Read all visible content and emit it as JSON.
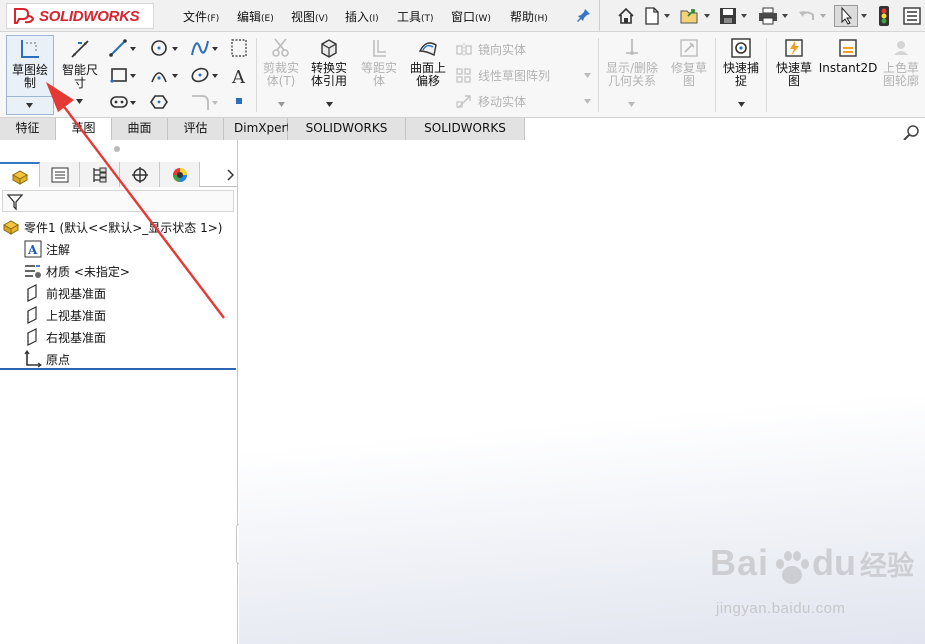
{
  "app": {
    "brand": "SOLIDWORKS",
    "accent_red": "#d9232e",
    "selection_blue": "#3a74c4"
  },
  "menubar": {
    "items": [
      {
        "label": "文件",
        "key": "(F)"
      },
      {
        "label": "编辑",
        "key": "(E)"
      },
      {
        "label": "视图",
        "key": "(V)"
      },
      {
        "label": "插入",
        "key": "(I)"
      },
      {
        "label": "工具",
        "key": "(T)"
      },
      {
        "label": "窗口",
        "key": "(W)"
      },
      {
        "label": "帮助",
        "key": "(H)"
      }
    ],
    "pin_icon": "pin-icon",
    "quick_access_icons": [
      "home-icon",
      "new-document-icon",
      "open-folder-icon",
      "save-icon",
      "print-icon",
      "undo-icon",
      "select-cursor-icon",
      "traffic-light-icon",
      "options-list-icon"
    ]
  },
  "ribbon": {
    "sketch": {
      "label1": "草图绘",
      "label2": "制"
    },
    "smart_dimension": {
      "label1": "智能尺",
      "label2": "寸"
    },
    "trim": {
      "label1": "剪裁实",
      "label2": "体(T)"
    },
    "convert": {
      "label1": "转换实",
      "label2": "体引用"
    },
    "offset": {
      "label1": "等距实",
      "label2": "体"
    },
    "offset_surface": {
      "label1": "曲面上",
      "label2": "偏移"
    },
    "mirror": "镜向实体",
    "linear_pattern": "线性草图阵列",
    "move": "移动实体",
    "display_relations": {
      "label1": "显示/删除",
      "label2": "几何关系"
    },
    "repair": {
      "label1": "修复草",
      "label2": "图"
    },
    "quick_snaps": {
      "label1": "快速捕",
      "label2": "捉"
    },
    "rapid_sketch": {
      "label1": "快速草",
      "label2": "图"
    },
    "instant2d": "Instant2D",
    "shaded_contours": {
      "label1": "上色草",
      "label2": "图轮廓"
    }
  },
  "tabs": [
    "特征",
    "草图",
    "曲面",
    "评估",
    "DimXpert",
    "SOLIDWORKS 插件",
    "SOLIDWORKS MBD"
  ],
  "active_tab": "草图",
  "feature_tree": {
    "root": "零件1  (默认<<默认>_显示状态 1>)",
    "items": [
      {
        "icon": "annotations-icon",
        "label": "注解"
      },
      {
        "icon": "material-icon",
        "label": "材质 <未指定>"
      },
      {
        "icon": "plane-icon",
        "label": "前视基准面"
      },
      {
        "icon": "plane-icon",
        "label": "上视基准面"
      },
      {
        "icon": "plane-icon",
        "label": "右视基准面"
      },
      {
        "icon": "origin-icon",
        "label": "原点"
      }
    ]
  },
  "watermark": {
    "left": "Bai",
    "right": "du",
    "cn": "经验",
    "url": "jingyan.baidu.com"
  }
}
